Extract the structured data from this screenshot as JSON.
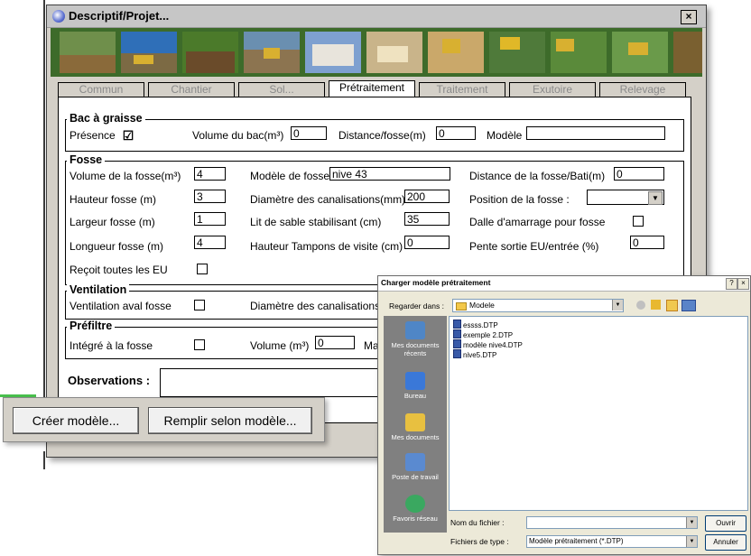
{
  "main_window": {
    "title": "Descriptif/Projet...",
    "close_glyph": "×",
    "tabs": [
      {
        "label": "Commun"
      },
      {
        "label": "Chantier"
      },
      {
        "label": "Sol..."
      },
      {
        "label": "Prétraitement"
      },
      {
        "label": "Traitement"
      },
      {
        "label": "Exutoire"
      },
      {
        "label": "Relevage"
      }
    ],
    "active_tab": "Prétraitement"
  },
  "bac": {
    "title": "Bac à graisse",
    "presence_label": "Présence",
    "presence_checked": "☑",
    "volume_label": "Volume du bac(m³)",
    "volume_value": "0",
    "distance_label": "Distance/fosse(m)",
    "distance_value": "0",
    "modele_label": "Modèle",
    "modele_value": ""
  },
  "fosse": {
    "title": "Fosse",
    "volume_label": "Volume de la fosse(m³)",
    "volume_value": "4",
    "hauteur_label": "Hauteur fosse (m)",
    "hauteur_value": "3",
    "largeur_label": "Largeur fosse (m)",
    "largeur_value": "1",
    "longueur_label": "Longueur fosse (m)",
    "longueur_value": "4",
    "recoit_label": "Reçoit toutes les EU",
    "modele_label": "Modèle de fosse",
    "modele_value": "nive 43",
    "diametre_label": "Diamètre des canalisations(mm)",
    "diametre_value": "200",
    "lit_label": "Lit de sable stabilisant (cm)",
    "lit_value": "35",
    "tampons_label": "Hauteur Tampons de visite (cm)",
    "tampons_value": "0",
    "distance_label": "Distance de la fosse/Bati(m)",
    "distance_value": "0",
    "position_label": "Position de la fosse :",
    "position_value": "",
    "dalle_label": "Dalle d'amarrage pour fosse",
    "pente_label": "Pente sortie EU/entrée (%)",
    "pente_value": "0"
  },
  "ventilation": {
    "title": "Ventilation",
    "aval_label": "Ventilation aval  fosse",
    "diametre_label": "Diamètre des canalisations"
  },
  "prefiltre": {
    "title": "Préfiltre",
    "integre_label": "Intégré à la fosse",
    "volume_label": "Volume (m³)",
    "volume_value": "0",
    "ma_label": "Ma"
  },
  "observations": {
    "label": "Observations :",
    "value": ""
  },
  "buttons": {
    "creer": "Créer modèle...",
    "remplir": "Remplir selon modèle..."
  },
  "dialog": {
    "title": "Charger modèle prétraitement",
    "help_glyph": "?",
    "close_glyph": "×",
    "lookin_label": "Regarder dans :",
    "lookin_value": "Modele",
    "places": [
      {
        "label": "Mes documents récents",
        "icon": "recent-documents-icon"
      },
      {
        "label": "Bureau",
        "icon": "desktop-icon"
      },
      {
        "label": "Mes documents",
        "icon": "my-documents-icon"
      },
      {
        "label": "Poste de travail",
        "icon": "computer-icon"
      },
      {
        "label": "Favoris réseau",
        "icon": "network-icon"
      }
    ],
    "files": [
      "essss.DTP",
      "exemple 2.DTP",
      "modèle nive4.DTP",
      "nive5.DTP"
    ],
    "filename_label": "Nom du fichier :",
    "filename_value": "",
    "filetype_label": "Fichiers de type :",
    "filetype_value": "Modèle prétraitement (*.DTP)",
    "open_button": "Ouvrir",
    "cancel_button": "Annuler"
  }
}
